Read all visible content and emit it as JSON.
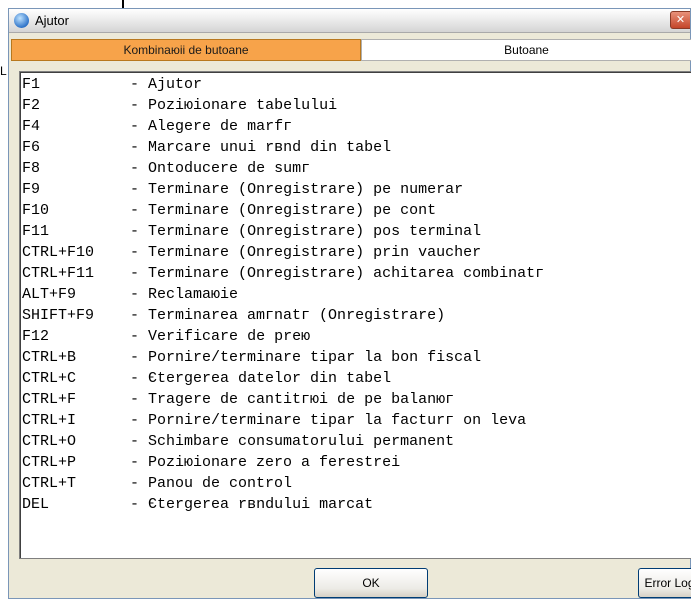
{
  "background": {
    "edge_char": "L"
  },
  "window": {
    "title": "Ajutor",
    "close_glyph": "✕"
  },
  "tabs": [
    {
      "label": "Kombinaюii de butoane",
      "active": true
    },
    {
      "label": "Butoane",
      "active": false
    }
  ],
  "shortcuts": [
    {
      "key": "F1",
      "desc": "Ajutor"
    },
    {
      "key": "F2",
      "desc": "Poziюionare tabelului"
    },
    {
      "key": "F4",
      "desc": "Alegere de marfг"
    },
    {
      "key": "F6",
      "desc": "Marcare unui rвnd din tabel"
    },
    {
      "key": "F8",
      "desc": "Оntoducere de sumг"
    },
    {
      "key": "F9",
      "desc": "Terminare (Оnregistrare) pe numerar"
    },
    {
      "key": "F10",
      "desc": "Terminare (Оnregistrare) pe cont"
    },
    {
      "key": "F11",
      "desc": "Terminare (Оnregistrare) pos terminal"
    },
    {
      "key": "CTRL+F10",
      "desc": "Terminare (Оnregistrare) prin vaucher"
    },
    {
      "key": "CTRL+F11",
      "desc": "Terminare (Оnregistrare) achitarea combinatг"
    },
    {
      "key": "ALT+F9",
      "desc": "Reclamaюie"
    },
    {
      "key": "SHIFT+F9",
      "desc": "Terminarea amгnatг (Оnregistrare)"
    },
    {
      "key": "F12",
      "desc": "Verificare de preю"
    },
    {
      "key": "CTRL+B",
      "desc": "Pornire/terminare tipar la bon fiscal"
    },
    {
      "key": "CTRL+C",
      "desc": "Єtergerea datelor din tabel"
    },
    {
      "key": "CTRL+F",
      "desc": "Tragere de cantitгюi de pe balanюг"
    },
    {
      "key": "CTRL+I",
      "desc": "Pornire/terminare tipar la facturг оn leva"
    },
    {
      "key": "CTRL+O",
      "desc": "Schimbare consumatorului permanent"
    },
    {
      "key": "CTRL+P",
      "desc": "Poziюionare zero a ferestrei"
    },
    {
      "key": "CTRL+T",
      "desc": "Panou de control"
    },
    {
      "key": "DEL",
      "desc": "Єtergerea rвndului marcat"
    }
  ],
  "buttons": {
    "ok_label": "OK",
    "error_log_label": "Error Log"
  }
}
